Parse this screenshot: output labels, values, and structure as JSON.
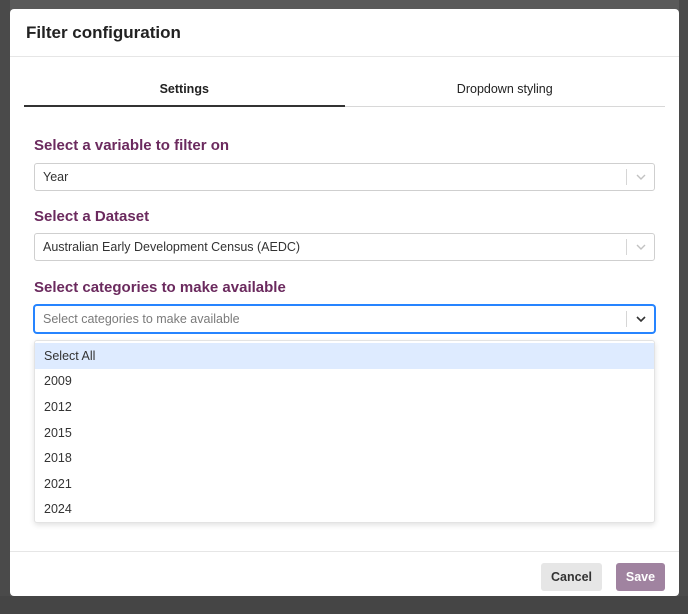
{
  "dialog": {
    "title": "Filter configuration"
  },
  "tabs": [
    {
      "label": "Settings",
      "active": true
    },
    {
      "label": "Dropdown styling",
      "active": false
    }
  ],
  "variable_section": {
    "label": "Select a variable to filter on",
    "value": "Year"
  },
  "dataset_section": {
    "label": "Select a Dataset",
    "value": "Australian Early Development Census (AEDC)"
  },
  "categories_section": {
    "label": "Select categories to make available",
    "placeholder": "Select categories to make available",
    "options": [
      "Select All",
      "2009",
      "2012",
      "2015",
      "2018",
      "2021",
      "2024"
    ],
    "highlighted_index": 0
  },
  "footer": {
    "cancel_label": "Cancel",
    "save_label": "Save"
  },
  "colors": {
    "section_label": "#6b2a5e",
    "save_button": "#a083a0",
    "highlight": "#deebff",
    "focus_border": "#2684ff"
  }
}
